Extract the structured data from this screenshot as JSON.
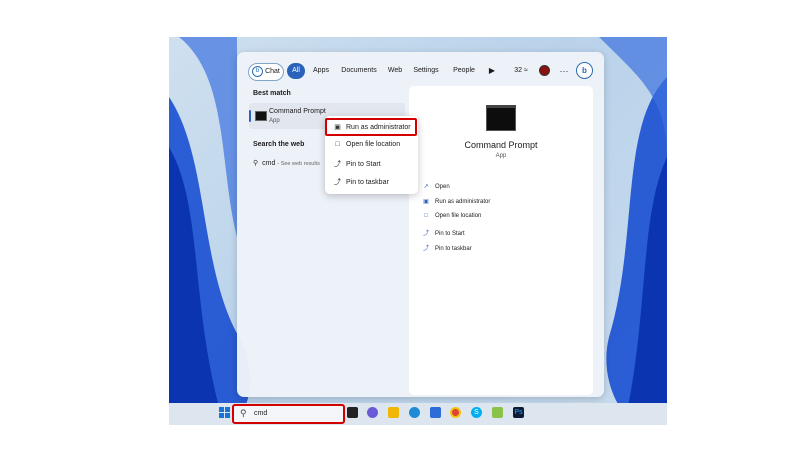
{
  "filters": {
    "chat": "Chat",
    "all": "All",
    "apps": "Apps",
    "documents": "Documents",
    "web": "Web",
    "settings": "Settings",
    "people": "People",
    "temperature": "32"
  },
  "left": {
    "best_match_title": "Best match",
    "best_item_name": "Command Prompt",
    "best_item_type": "App",
    "search_web_title": "Search the web",
    "web_query": "cmd",
    "web_hint": "- See web results"
  },
  "detail": {
    "title": "Command Prompt",
    "type": "App",
    "actions": [
      "Open",
      "Run as administrator",
      "Open file location",
      "Pin to Start",
      "Pin to taskbar"
    ]
  },
  "context_menu": {
    "items": [
      "Run as administrator",
      "Open file location",
      "Pin to Start",
      "Pin to taskbar"
    ]
  },
  "taskbar": {
    "search_value": "cmd"
  },
  "colors": {
    "accent": "#2b62b9",
    "highlight": "#d40000"
  }
}
